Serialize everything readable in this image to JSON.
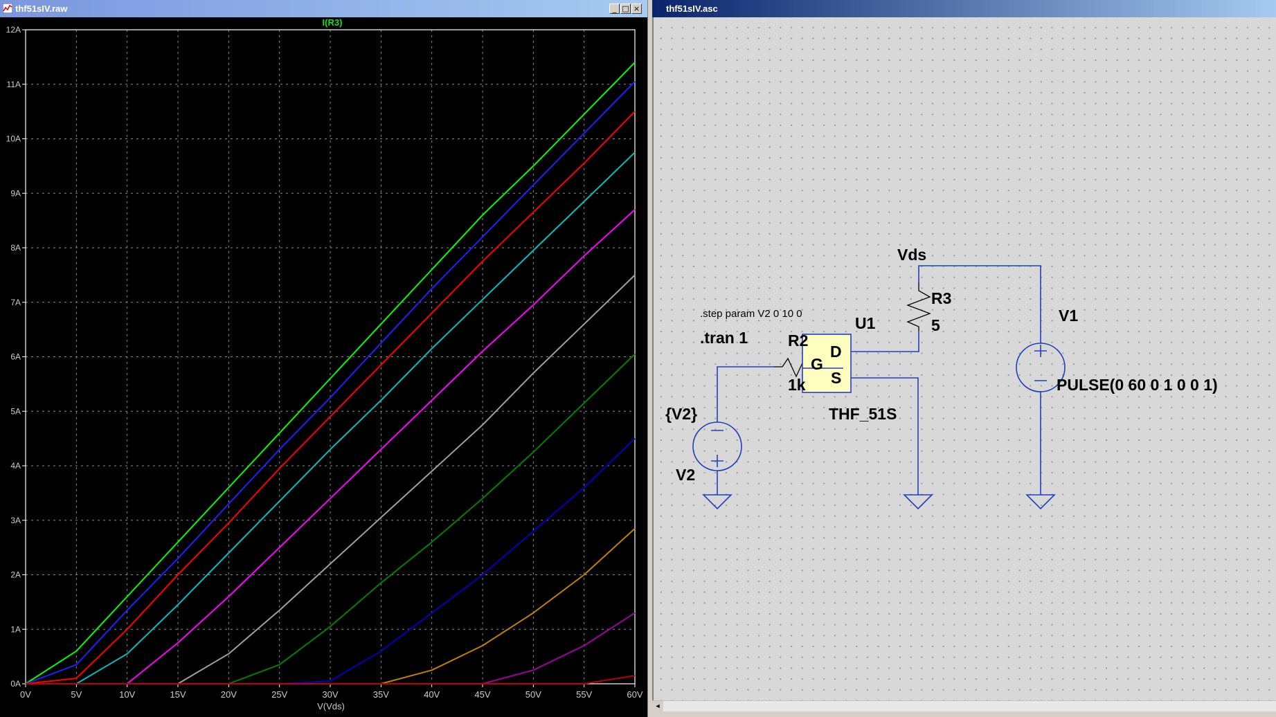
{
  "plot_window": {
    "title": "thf51sIV.raw",
    "trace_label": "I(R3)",
    "controls": [
      "_",
      "□",
      "×"
    ]
  },
  "schematic_window": {
    "title": "thf51sIV.asc",
    "scroll_left": "◄"
  },
  "colors": {
    "plot_background": "#000000",
    "grid": "#8a8a8a",
    "wire": "#1f3fbf",
    "component_fill": "#ffffc0"
  },
  "schematic": {
    "net_vds": "Vds",
    "step_directive": ".step param V2 0 10 0",
    "tran_directive": ".tran 1",
    "r2_name": "R2",
    "r2_value": "1k",
    "r3_name": "R3",
    "r3_value": "5",
    "u1_name": "U1",
    "u1_model": "THF_51S",
    "pin_g": "G",
    "pin_d": "D",
    "pin_s": "S",
    "v1_name": "V1",
    "v1_value": "PULSE(0 60 0 1 0 0 1)",
    "v2_name": "V2",
    "v2_value": "{V2}"
  },
  "chart_data": {
    "type": "line",
    "title": "I(R3)",
    "xlabel": "V(Vds)",
    "ylabel": "",
    "xlim": [
      0,
      60
    ],
    "ylim": [
      0,
      12
    ],
    "x_ticks": [
      "0V",
      "5V",
      "10V",
      "15V",
      "20V",
      "25V",
      "30V",
      "35V",
      "40V",
      "45V",
      "50V",
      "55V",
      "60V"
    ],
    "y_ticks": [
      "0A",
      "1A",
      "2A",
      "3A",
      "4A",
      "5A",
      "6A",
      "7A",
      "8A",
      "9A",
      "10A",
      "11A",
      "12A"
    ],
    "grid": true,
    "x": [
      0,
      5,
      10,
      15,
      20,
      25,
      30,
      35,
      40,
      45,
      50,
      55,
      60
    ],
    "series": [
      {
        "color": "#00ff00",
        "values": [
          0.0,
          0.6,
          1.6,
          2.6,
          3.6,
          4.6,
          5.6,
          6.6,
          7.6,
          8.6,
          9.5,
          10.45,
          11.4
        ]
      },
      {
        "color": "#2020ff",
        "values": [
          0.0,
          0.35,
          1.35,
          2.3,
          3.3,
          4.3,
          5.25,
          6.25,
          7.25,
          8.2,
          9.15,
          10.1,
          11.05
        ]
      },
      {
        "color": "#ff0000",
        "values": [
          0.0,
          0.1,
          1.0,
          2.0,
          2.95,
          3.95,
          4.9,
          5.85,
          6.8,
          7.75,
          8.65,
          9.55,
          10.5
        ]
      },
      {
        "color": "#00c0c0",
        "values": [
          0.0,
          0.0,
          0.55,
          1.45,
          2.4,
          3.35,
          4.3,
          5.2,
          6.15,
          7.05,
          7.95,
          8.85,
          9.75
        ]
      },
      {
        "color": "#ff00ff",
        "values": [
          0.0,
          0.0,
          0.0,
          0.75,
          1.6,
          2.5,
          3.4,
          4.3,
          5.2,
          6.1,
          6.95,
          7.85,
          8.7
        ]
      },
      {
        "color": "#a0a0a0",
        "values": [
          0.0,
          0.0,
          0.0,
          0.0,
          0.55,
          1.35,
          2.2,
          3.05,
          3.9,
          4.75,
          5.7,
          6.6,
          7.5
        ]
      },
      {
        "color": "#008000",
        "values": [
          0.0,
          0.0,
          0.0,
          0.0,
          0.0,
          0.35,
          1.05,
          1.85,
          2.6,
          3.4,
          4.25,
          5.15,
          6.05
        ]
      },
      {
        "color": "#0000c0",
        "values": [
          0.0,
          0.0,
          0.0,
          0.0,
          0.0,
          0.0,
          0.05,
          0.6,
          1.3,
          2.0,
          2.8,
          3.6,
          4.5
        ]
      },
      {
        "color": "#c08000",
        "values": [
          0.0,
          0.0,
          0.0,
          0.0,
          0.0,
          0.0,
          0.0,
          0.0,
          0.25,
          0.7,
          1.3,
          2.0,
          2.85
        ]
      },
      {
        "color": "#a000a0",
        "values": [
          0.0,
          0.0,
          0.0,
          0.0,
          0.0,
          0.0,
          0.0,
          0.0,
          0.0,
          0.0,
          0.25,
          0.7,
          1.3
        ]
      },
      {
        "color": "#c00000",
        "values": [
          0.0,
          0.0,
          0.0,
          0.0,
          0.0,
          0.0,
          0.0,
          0.0,
          0.0,
          0.0,
          0.0,
          0.0,
          0.15
        ]
      }
    ]
  }
}
